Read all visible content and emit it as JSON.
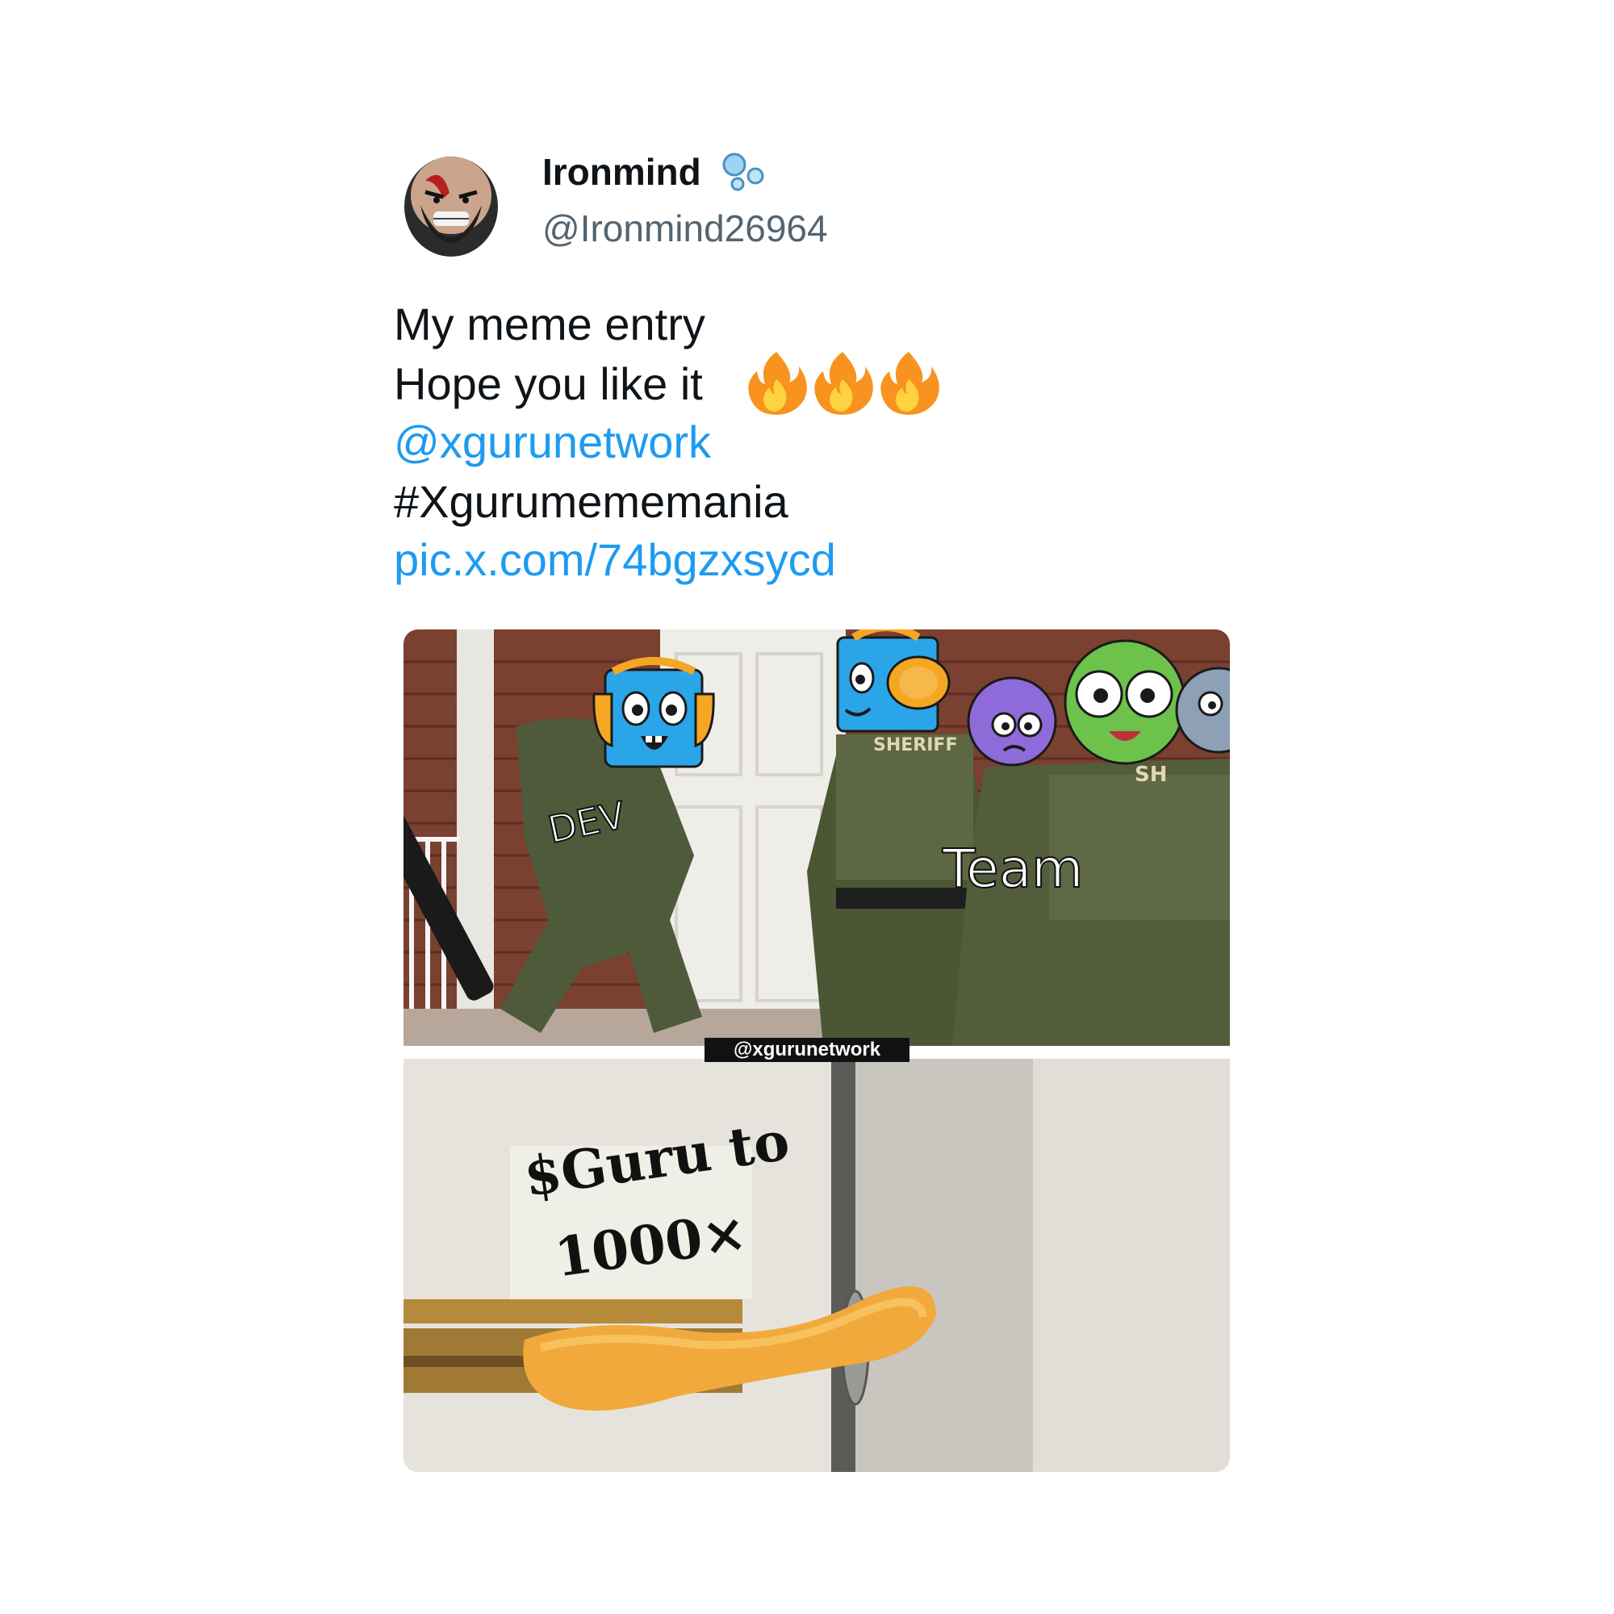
{
  "author": {
    "display_name": "Ironmind",
    "handle": "@Ironmind26964",
    "avatar_icon": "angry-warrior-avatar",
    "badge_icon": "bubbles-icon"
  },
  "tweet": {
    "line1": "My meme entry",
    "line2": "Hope you like it",
    "emoji_icons": [
      "fire-icon",
      "fire-icon",
      "fire-icon"
    ],
    "mention": "@xgurunetwork",
    "hashtag": "#Xgurumememania",
    "pic_link": "pic.x.com/74bgzxsycd"
  },
  "media": {
    "top_panel": {
      "label_dev": "DEV",
      "label_team": "Team",
      "watermark": "@xgurunetwork",
      "vest_text_1": "SHERIFF",
      "vest_text_2": "SH"
    },
    "bottom_panel": {
      "caption_line1": "$Guru to",
      "caption_line2": "1000×"
    }
  },
  "colors": {
    "link": "#1d9bf0",
    "text": "#0f1419",
    "muted": "#536471",
    "mascot_blue": "#2aa6e8",
    "mascot_orange": "#f5a623",
    "mascot_green": "#6cc24a",
    "mascot_purple": "#8e6bd9"
  }
}
